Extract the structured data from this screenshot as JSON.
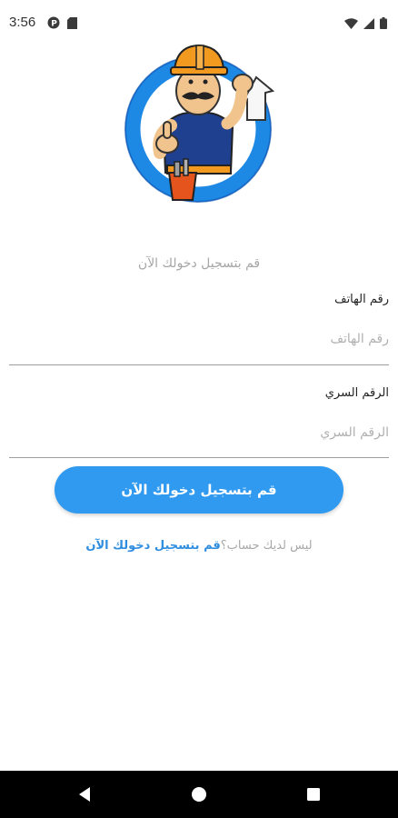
{
  "status_bar": {
    "time": "3:56"
  },
  "login": {
    "subtitle": "قم بتسجيل دخولك الآن",
    "phone": {
      "label": "رقم الهاتف",
      "placeholder": "رقم الهاتف"
    },
    "password": {
      "label": "الرقم السري",
      "placeholder": "الرقم السري"
    },
    "submit_label": "قم بتسجيل دخولك الآن",
    "register_prompt": "ليس لديك حساب؟",
    "register_link": "قم بتسجيل دخولك الآن"
  },
  "theme": {
    "accent": "#2f9af0",
    "link": "#2f8ee0",
    "ring": "#1e88e5"
  },
  "icons": [
    "record-icon",
    "sd-card-icon",
    "wifi-icon",
    "signal-icon",
    "battery-icon",
    "back-icon",
    "home-icon",
    "recents-icon"
  ]
}
